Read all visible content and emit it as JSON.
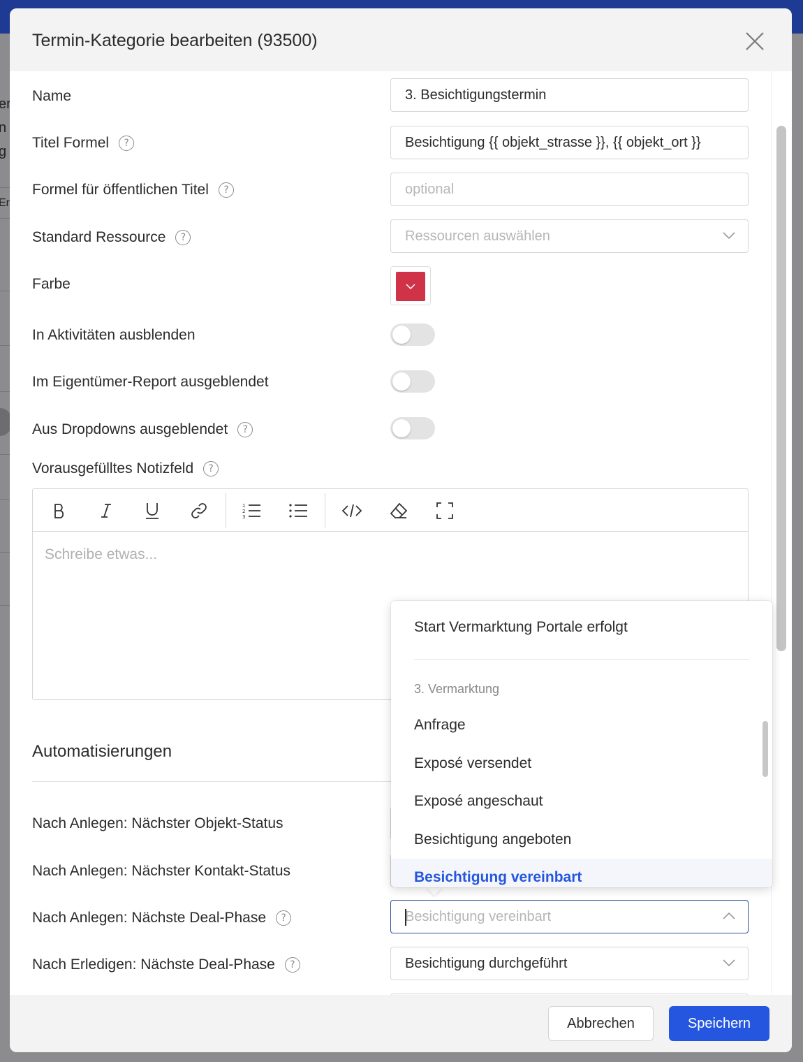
{
  "background": {
    "fragments": [
      "er",
      "n",
      "g",
      "En"
    ]
  },
  "modal": {
    "title": "Termin-Kategorie bearbeiten (93500)",
    "fields": {
      "name": {
        "label": "Name",
        "value": "3. Besichtigungstermin"
      },
      "title_formula": {
        "label": "Titel Formel",
        "value": "Besichtigung {{ objekt_strasse }}, {{ objekt_ort }}"
      },
      "public_title_formula": {
        "label": "Formel für öffentlichen Titel",
        "placeholder": "optional"
      },
      "default_resource": {
        "label": "Standard Ressource",
        "placeholder": "Ressourcen auswählen"
      },
      "color": {
        "label": "Farbe",
        "value": "#d03347"
      },
      "hide_in_activities": {
        "label": "In Aktivitäten ausblenden",
        "enabled": false
      },
      "hide_in_owner_report": {
        "label": "Im Eigentümer-Report ausgeblendet",
        "enabled": false
      },
      "hide_in_dropdowns": {
        "label": "Aus Dropdowns ausgeblendet",
        "enabled": false
      },
      "prefilled_note": {
        "label": "Vorausgefülltes Notizfeld",
        "placeholder": "Schreibe etwas..."
      }
    },
    "automations": {
      "title": "Automatisierungen",
      "next_object_status": {
        "label": "Nach Anlegen: Nächster Objekt-Status"
      },
      "next_contact_status": {
        "label": "Nach Anlegen: Nächster Kontakt-Status"
      },
      "next_deal_phase_create": {
        "label": "Nach Anlegen: Nächste Deal-Phase",
        "placeholder": "Besichtigung vereinbart"
      },
      "next_deal_phase_done": {
        "label": "Nach Erledigen: Nächste Deal-Phase",
        "value": "Besichtigung durchgeführt"
      }
    },
    "dropdown": {
      "items_before": [
        "Start Vermarktung Portale erfolgt"
      ],
      "group_label": "3. Vermarktung",
      "items": [
        "Anfrage",
        "Exposé versendet",
        "Exposé angeschaut",
        "Besichtigung angeboten",
        "Besichtigung vereinbart"
      ],
      "selected": "Besichtigung vereinbart",
      "selected_color": "#2456e0"
    },
    "footer": {
      "cancel_label": "Abbrechen",
      "save_label": "Speichern",
      "save_color": "#2456e0"
    }
  }
}
